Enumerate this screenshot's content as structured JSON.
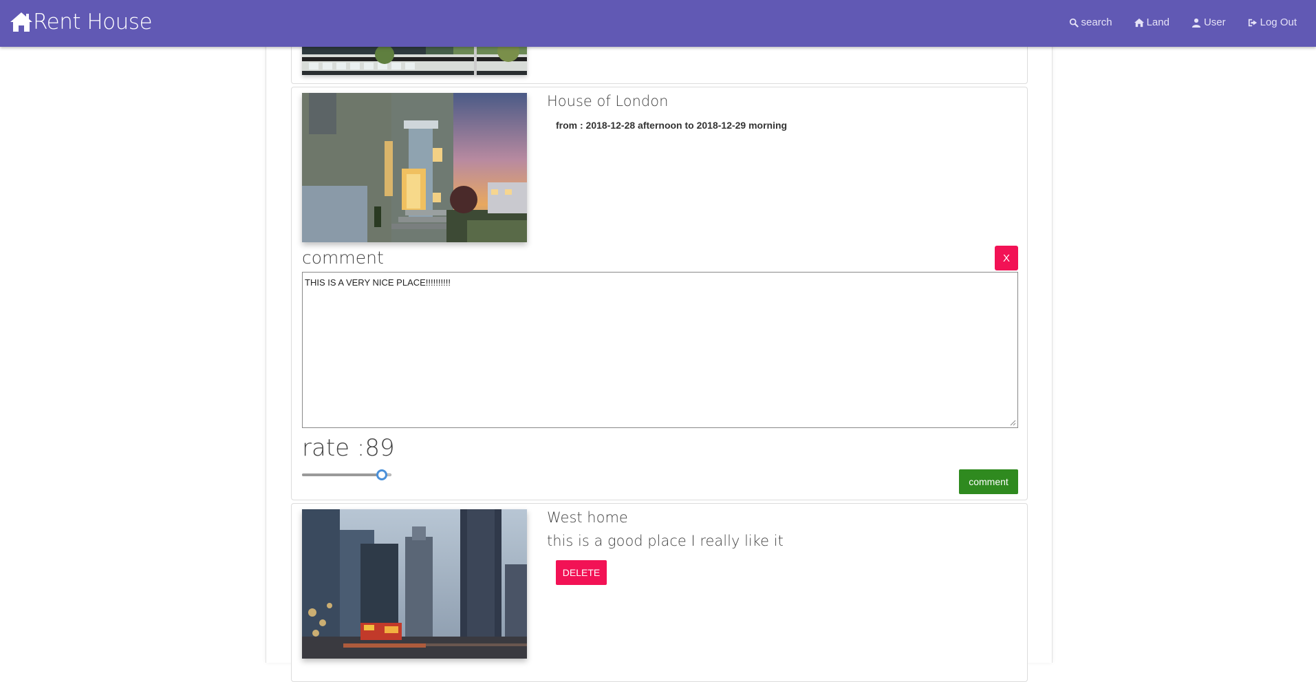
{
  "navbar": {
    "brand": "Rent House",
    "links": [
      {
        "label": "search",
        "icon": "search-icon"
      },
      {
        "label": "Land",
        "icon": "home-icon"
      },
      {
        "label": "User",
        "icon": "user-icon"
      },
      {
        "label": "Log Out",
        "icon": "sign-out-icon"
      }
    ],
    "background": "#6159b4"
  },
  "cards": [
    {
      "title": "House of London",
      "dates": "from : 2018-12-28 afternoon to 2018-12-29 morning",
      "comment_label": "comment",
      "close_label": "X",
      "comment_text": "THIS  IS  A  VERY NICE PLACE!!!!!!!!!!",
      "rate_label": "rate :89",
      "rate_value": 89,
      "rate_max": 100,
      "submit_label": "comment"
    },
    {
      "title": "West home",
      "review": "this is a good place I really like it",
      "delete_label": "DELETE"
    }
  ],
  "colors": {
    "accent_red": "#f21255",
    "accent_green": "#2f8a1f",
    "slider_thumb": "#4a90d9"
  }
}
